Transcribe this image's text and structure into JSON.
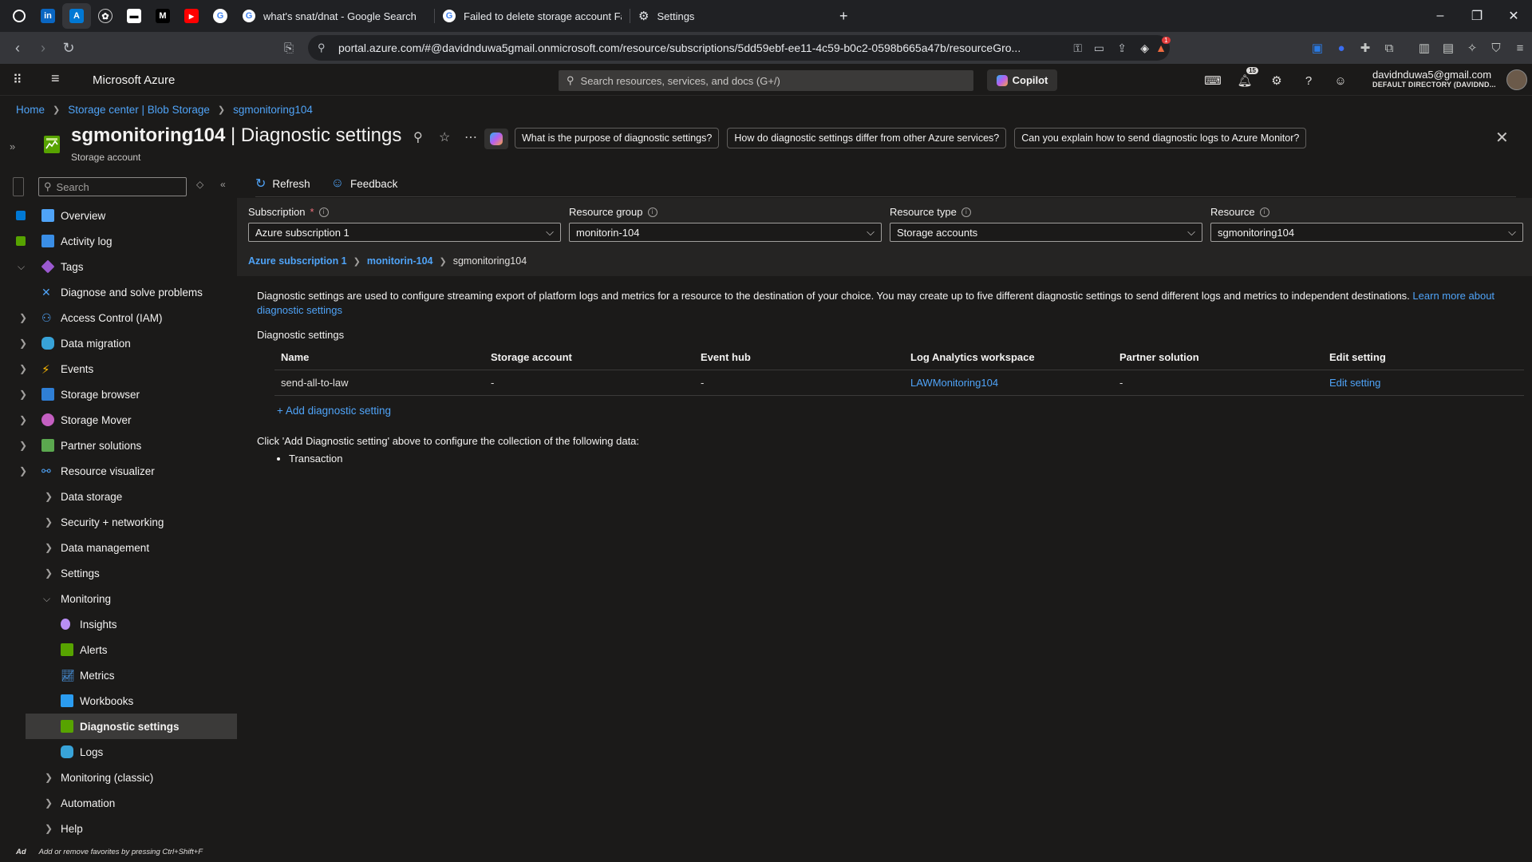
{
  "browser": {
    "tabs": [
      {
        "title": "what's snat/dnat - Google Search"
      },
      {
        "title": "Failed to delete storage account Faile"
      },
      {
        "title": "Settings"
      }
    ],
    "url": "portal.azure.com/#@davidnduwa5gmail.onmicrosoft.com/resource/subscriptions/5dd59ebf-ee11-4c59-b0c2-0598b665a47b/resourceGro...",
    "notification_badge": "1",
    "new_tab_symbol": "+"
  },
  "portal": {
    "brand": "Microsoft Azure",
    "search_placeholder": "Search resources, services, and docs (G+/)",
    "copilot_label": "Copilot",
    "notif_count": "15",
    "user_email": "davidnduwa5@gmail.com",
    "user_directory": "DEFAULT DIRECTORY (DAVIDND..."
  },
  "breadcrumb": {
    "items": [
      "Home",
      "Storage center | Blob Storage",
      "sgmonitoring104"
    ]
  },
  "page": {
    "title_resource": "sgmonitoring104",
    "title_section": " | Diagnostic settings",
    "subtitle": "Storage account",
    "suggestions": [
      "What is the purpose of diagnostic settings?",
      "How do diagnostic settings differ from other Azure services?",
      "Can you explain how to send diagnostic logs to Azure Monitor?"
    ]
  },
  "sidebar": {
    "search_placeholder": "Search",
    "items": [
      {
        "label": "Overview"
      },
      {
        "label": "Activity log"
      },
      {
        "label": "Tags"
      },
      {
        "label": "Diagnose and solve problems"
      },
      {
        "label": "Access Control (IAM)"
      },
      {
        "label": "Data migration"
      },
      {
        "label": "Events"
      },
      {
        "label": "Storage browser"
      },
      {
        "label": "Storage Mover"
      },
      {
        "label": "Partner solutions"
      },
      {
        "label": "Resource visualizer"
      },
      {
        "label": "Data storage"
      },
      {
        "label": "Security + networking"
      },
      {
        "label": "Data management"
      },
      {
        "label": "Settings"
      },
      {
        "label": "Monitoring"
      },
      {
        "label": "Insights"
      },
      {
        "label": "Alerts"
      },
      {
        "label": "Metrics"
      },
      {
        "label": "Workbooks"
      },
      {
        "label": "Diagnostic settings"
      },
      {
        "label": "Logs"
      },
      {
        "label": "Monitoring (classic)"
      },
      {
        "label": "Automation"
      },
      {
        "label": "Help"
      }
    ],
    "footer_prefix": "Ad",
    "footer_hint": "Add or remove favorites by pressing Ctrl+Shift+F"
  },
  "toolbar": {
    "refresh_label": "Refresh",
    "feedback_label": "Feedback"
  },
  "filters": {
    "subscription_label": "Subscription",
    "subscription_required": "*",
    "subscription_value": "Azure subscription 1",
    "resource_group_label": "Resource group",
    "resource_group_value": "monitorin-104",
    "resource_type_label": "Resource type",
    "resource_type_value": "Storage accounts",
    "resource_label": "Resource",
    "resource_value": "sgmonitoring104",
    "scope": [
      "Azure subscription 1",
      "monitorin-104",
      "sgmonitoring104"
    ]
  },
  "content": {
    "description": "Diagnostic settings are used to configure streaming export of platform logs and metrics for a resource to the destination of your choice. You may create up to five different diagnostic settings to send different logs and metrics to independent destinations.",
    "learn_more": "Learn more about diagnostic settings",
    "section_title": "Diagnostic settings",
    "columns": [
      "Name",
      "Storage account",
      "Event hub",
      "Log Analytics workspace",
      "Partner solution",
      "Edit setting"
    ],
    "rows": [
      {
        "name": "send-all-to-law",
        "storage_account": "-",
        "event_hub": "-",
        "log_analytics": "LAWMonitoring104",
        "partner": "-",
        "edit": "Edit setting"
      }
    ],
    "add_label": "+ Add diagnostic setting",
    "click_info": "Click 'Add Diagnostic setting' above to configure the collection of the following data:",
    "data_items": [
      "Transaction"
    ]
  }
}
